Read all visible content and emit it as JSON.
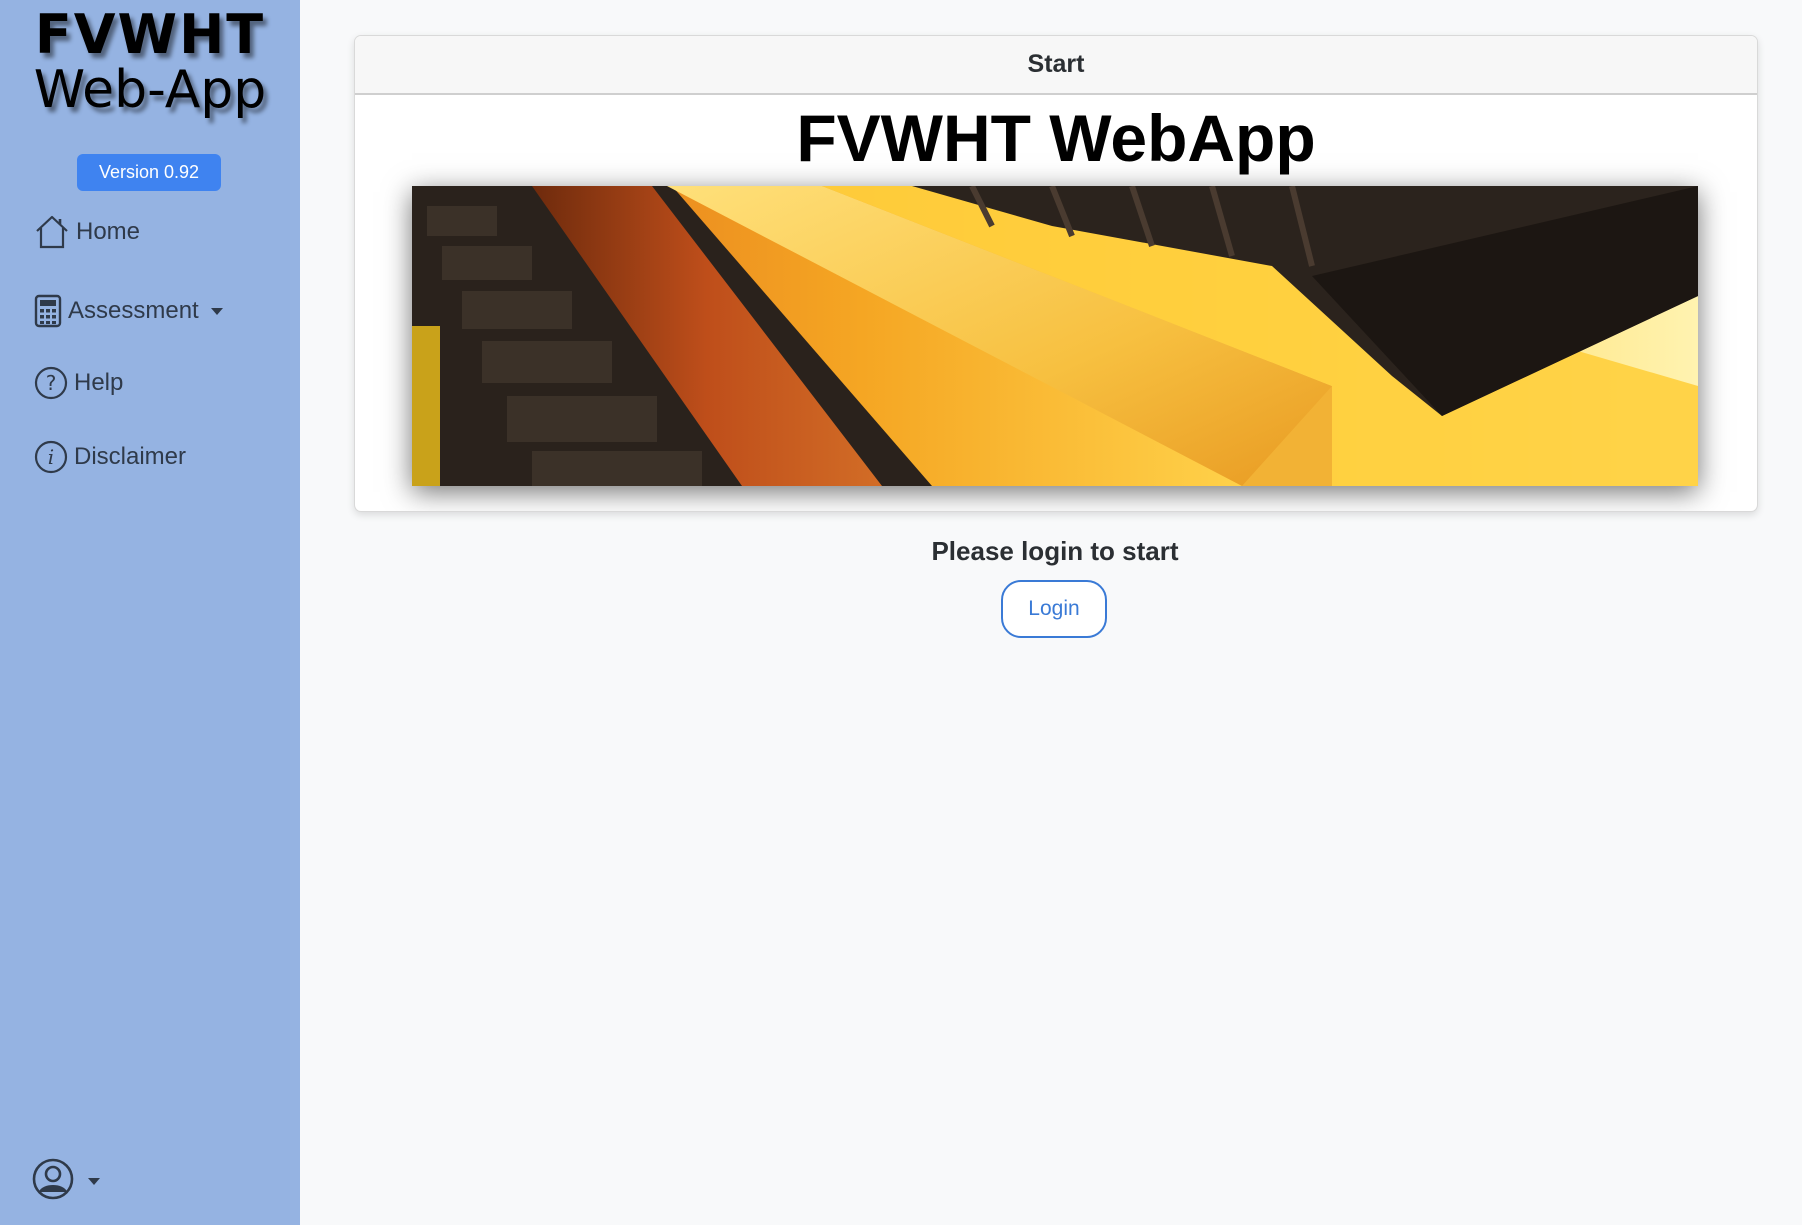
{
  "sidebar": {
    "brand": {
      "line1": "FVWHT",
      "line2": "Web-App"
    },
    "version": "Version 0.92",
    "nav": [
      {
        "label": "Home",
        "icon": "home-icon"
      },
      {
        "label": "Assessment",
        "icon": "calculator-icon",
        "has_dropdown": true
      },
      {
        "label": "Help",
        "icon": "question-circle-icon"
      },
      {
        "label": "Disclaimer",
        "icon": "info-circle-icon"
      }
    ],
    "user_menu": {
      "icon": "user-circle-icon",
      "has_dropdown": true
    }
  },
  "main": {
    "card": {
      "header": "Start",
      "title": "FVWHT WebApp",
      "banner_image": "hot-steel-bar-rolling-mill"
    },
    "login_prompt": "Please login to start",
    "login_button": "Login"
  },
  "colors": {
    "sidebar_bg": "#95b3e2",
    "badge_bg": "#3f83f0",
    "button_accent": "#3a7ad6",
    "page_bg": "#f8f9fa"
  }
}
